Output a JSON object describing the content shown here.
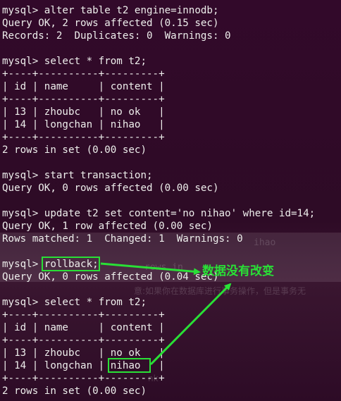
{
  "terminal": {
    "lines": [
      "mysql> alter table t2 engine=innodb;",
      "Query OK, 2 rows affected (0.15 sec)",
      "Records: 2  Duplicates: 0  Warnings: 0",
      "",
      "mysql> select * from t2;",
      "+----+----------+---------+",
      "| id | name     | content |",
      "+----+----------+---------+",
      "| 13 | zhoubc   | no ok   |",
      "| 14 | longchan | nihao   |",
      "+----+----------+---------+",
      "2 rows in set (0.00 sec)",
      "",
      "mysql> start transaction;",
      "Query OK, 0 rows affected (0.00 sec)",
      "",
      "mysql> update t2 set content='no nihao' where id=14;",
      "Query OK, 1 row affected (0.00 sec)",
      "Rows matched: 1  Changed: 1  Warnings: 0",
      "",
      "mysql> rollback;",
      "Query OK, 0 rows affected (0.04 sec)",
      "",
      "mysql> select * from t2;",
      "+----+----------+---------+",
      "| id | name     | content |",
      "+----+----------+---------+",
      "| 13 | zhoubc   | no ok   |",
      "| 14 | longchan | nihao   |",
      "+----+----------+---------+",
      "2 rows in set (0.00 sec)"
    ]
  },
  "annotation": {
    "text": "数据没有改变",
    "color": "#29e036"
  },
  "background_bleed": {
    "notice": "意:如果你在数据库进行事务操作，但是事务无",
    "fragment_1": "ihao",
    "fragment_2": "rows in",
    "fragment_3": "nk"
  }
}
